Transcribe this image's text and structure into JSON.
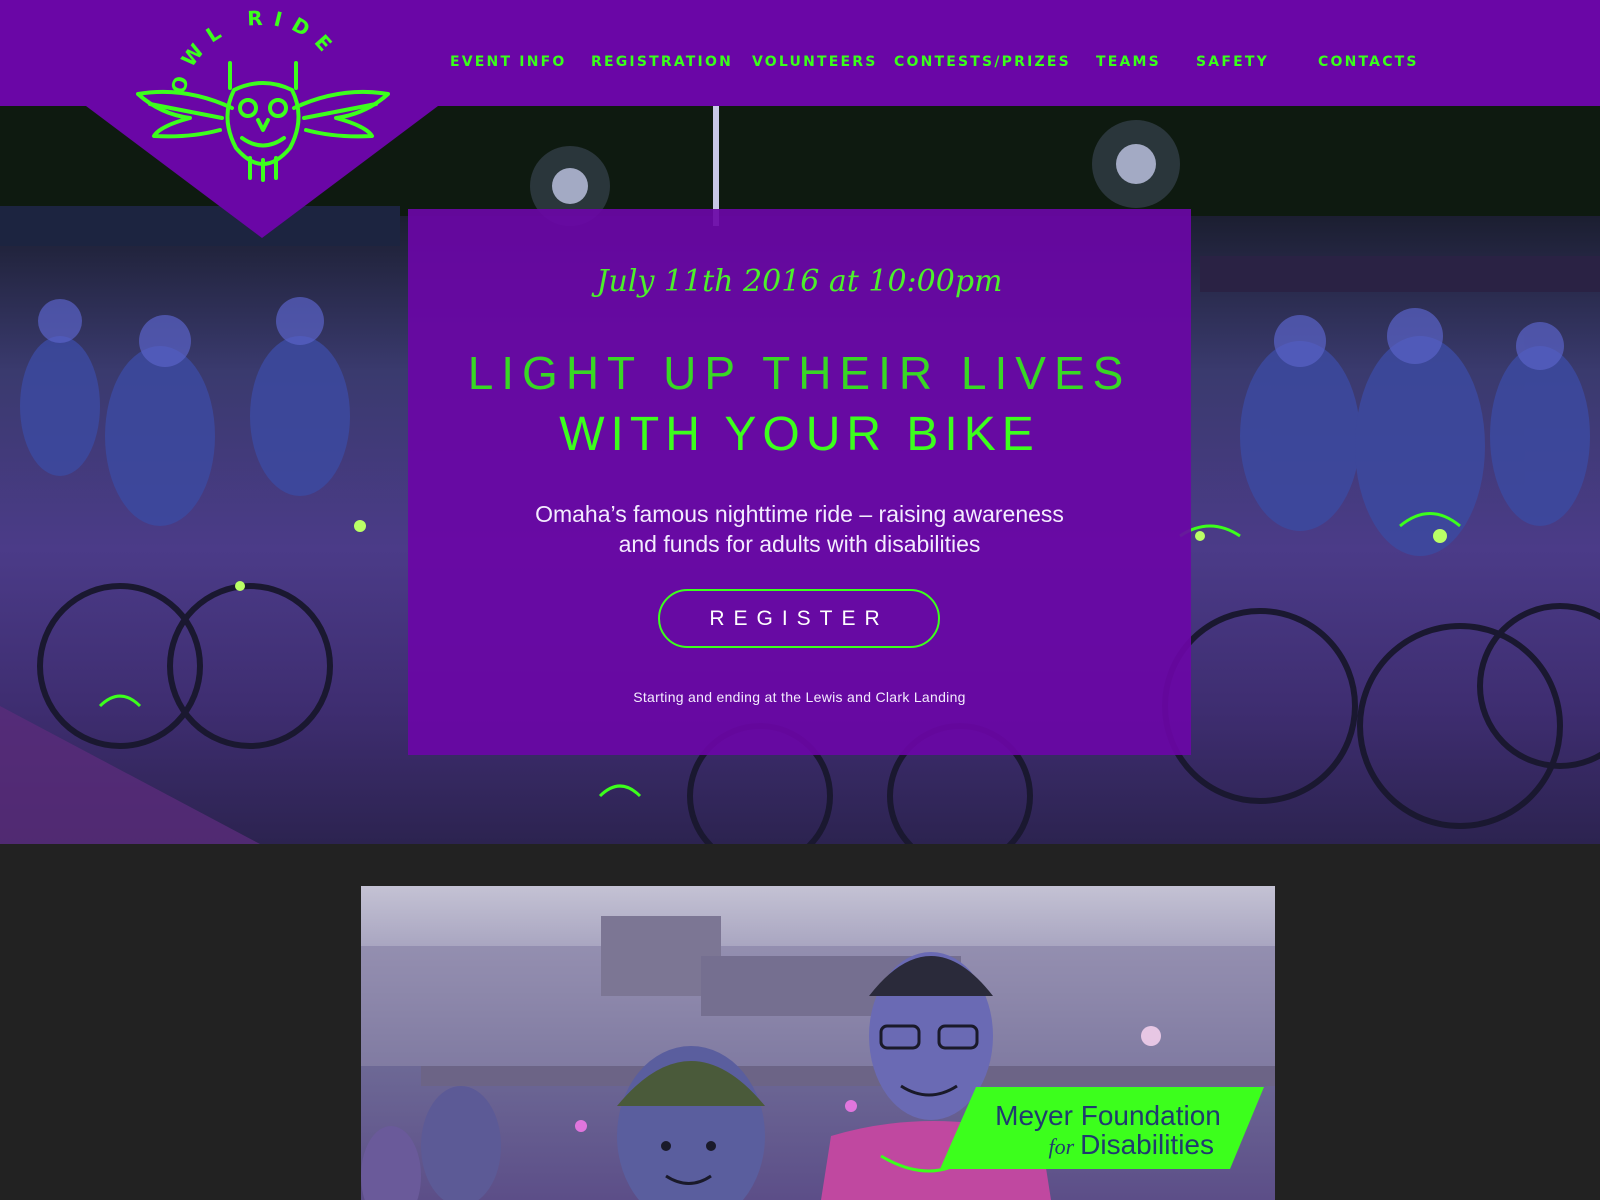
{
  "brand": {
    "logo_text": "OWL RIDE",
    "colors": {
      "purple": "#6a06a6",
      "neon_green": "#3cff1c",
      "dark_bg": "#222222"
    }
  },
  "nav": {
    "items": [
      {
        "label": "EVENT INFO"
      },
      {
        "label": "REGISTRATION"
      },
      {
        "label": "VOLUNTEERS"
      },
      {
        "label": "CONTESTS/PRIZES"
      },
      {
        "label": "TEAMS"
      },
      {
        "label": "SAFETY"
      },
      {
        "label": "CONTACTS"
      }
    ]
  },
  "hero": {
    "date": "July 11th 2016 at 10:00pm",
    "headline_line1": "LIGHT UP THEIR LIVES",
    "headline_line2": "WITH YOUR BIKE",
    "description_line1": "Omaha’s famous nighttime ride – raising awareness",
    "description_line2": "and funds for adults with disabilities",
    "register_label": "REGISTER",
    "location": "Starting and ending at the Lewis and Clark Landing",
    "background": "night-bike-crowd-photo"
  },
  "feature": {
    "photo": "riders-smiling-photo",
    "badge_line1": "Meyer Foundation",
    "badge_for": "for",
    "badge_line2": "Disabilities"
  }
}
